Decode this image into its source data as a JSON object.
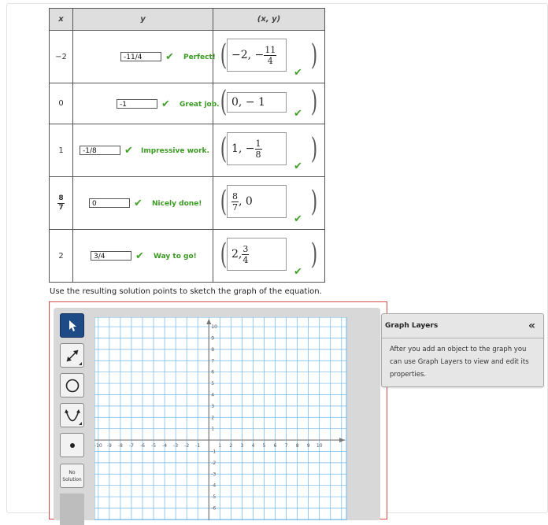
{
  "table": {
    "headers": {
      "x": "x",
      "y": "y",
      "point": "(x, y)"
    },
    "rows": [
      {
        "x": "−2",
        "y_input": "-11/4",
        "feedback": "Perfect!",
        "pt_whole": "−2, −",
        "pt_num": "11",
        "pt_den": "4"
      },
      {
        "x": "0",
        "y_input": "-1",
        "feedback": "Great job.",
        "pt_text": "0, − 1"
      },
      {
        "x": "1",
        "y_input": "-1/8",
        "feedback": "Impressive work.",
        "pt_whole": "1, −",
        "pt_num": "1",
        "pt_den": "8"
      },
      {
        "x_num": "8",
        "x_den": "7",
        "y_input": "0",
        "feedback": "Nicely done!",
        "pt_num": "8",
        "pt_den": "7",
        "pt_rest": ", 0"
      },
      {
        "x": "2",
        "y_input": "3/4",
        "feedback": "Way to go!",
        "pt_whole": "2,",
        "pt_num": "3",
        "pt_den": "4"
      }
    ]
  },
  "instruction": "Use the resulting solution points to sketch the graph of the equation.",
  "graph_tools": {
    "items": [
      "pointer-icon",
      "line-icon",
      "circle-icon",
      "parabola-icon",
      "point-icon"
    ],
    "no_solution_line1": "No",
    "no_solution_line2": "Solution"
  },
  "graph": {
    "x_min": -10,
    "x_max": 10,
    "y_min": -6,
    "y_max": 10,
    "x_ticks": [
      "-10",
      "-9",
      "-8",
      "-7",
      "-6",
      "-5",
      "-4",
      "-3",
      "-2",
      "-1",
      "1",
      "2",
      "3",
      "4",
      "5",
      "6",
      "7",
      "8",
      "9",
      "10"
    ],
    "y_ticks": [
      "10",
      "9",
      "8",
      "7",
      "6",
      "5",
      "4",
      "3",
      "2",
      "1",
      "-1",
      "-2",
      "-3",
      "-4",
      "-5",
      "-6"
    ],
    "grid_color": "#6fb4e6",
    "axis_color": "#777777"
  },
  "layers_panel": {
    "title": "Graph Layers",
    "collapse_glyph": "«",
    "description": "After you add an object to the graph you can use Graph Layers to view and edit its properties."
  },
  "colors": {
    "check": "#44a02a",
    "feedback": "#3a9a22",
    "active_tool": "#1e4a86",
    "red_outline": "#d74b4b"
  }
}
